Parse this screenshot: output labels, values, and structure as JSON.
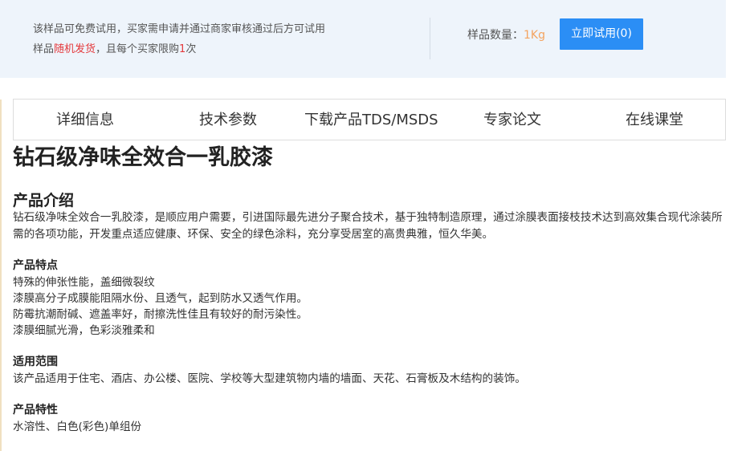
{
  "sample": {
    "line1": "该样品可免费试用，买家需申请并通过商家审核通过后方可试用",
    "line2_prefix": "样品",
    "line2_highlight": "随机发货",
    "line2_middle": "，且每个买家限购",
    "line2_limit": "1",
    "line2_suffix": "次",
    "qty_label": "样品数量：",
    "qty_value": "1Kg",
    "trial_button": "立即试用(0)"
  },
  "tabs": [
    {
      "label": "详细信息"
    },
    {
      "label": "技术参数"
    },
    {
      "label": "下载产品TDS/MSDS"
    },
    {
      "label": "专家论文"
    },
    {
      "label": "在线课堂"
    }
  ],
  "product": {
    "title": "钻石级净味全效合一乳胶漆",
    "intro_heading": "产品介绍",
    "intro_text": "钻石级净味全效合一乳胶漆，是顺应用户需要，引进国际最先进分子聚合技术，基于独特制造原理，通过涂膜表面接枝技术达到高效集合现代涂装所需的各项功能，开发重点适应健康、环保、安全的绿色涂料，充分享受居室的高贵典雅，恒久华美。",
    "features_heading": "产品特点",
    "features": [
      "特殊的伸张性能，盖细微裂纹",
      "漆膜高分子成膜能阻隔水份、且透气，起到防水又透气作用。",
      "防霉抗潮耐碱、遮盖率好，耐擦洗性佳且有较好的耐污染性。",
      "漆膜细腻光滑，色彩淡雅柔和"
    ],
    "scope_heading": "适用范围",
    "scope_text": "该产品适用于住宅、酒店、办公楼、医院、学校等大型建筑物内墙的墙面、天花、石膏板及木结构的装饰。",
    "property_heading": "产品特性",
    "property_text": "水溶性、白色(彩色)单组份"
  },
  "colors": {
    "accent": "#2b8ef5",
    "highlight_red": "#e4393c",
    "qty_orange": "#f4a460",
    "sample_bg": "#eef4fb"
  }
}
